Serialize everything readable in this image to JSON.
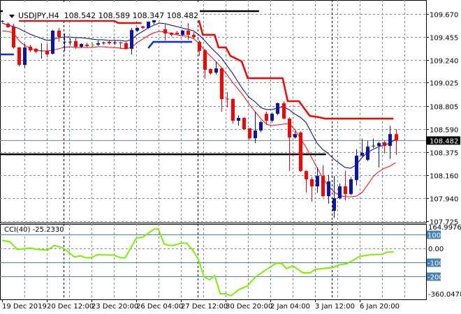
{
  "header": {
    "symbol": "USDJPY,H4",
    "ohlc": "108.542 108.589 108.347 108.482"
  },
  "cci_header": {
    "label": "CCI(40) -25.2330"
  },
  "colors": {
    "bull": "#0a14a8",
    "bear": "#ff0000",
    "doji_highlight": "#00ee00",
    "ma_line": "#000080",
    "lower_line": "#ff0000",
    "step_line": "#ff0000",
    "blue_step": "#0a28ff",
    "cci_line": "#7cf000",
    "cci_level": "#4682b4",
    "grid": "#778899"
  },
  "chart_data": [
    {
      "type": "candlestick",
      "title": "USDJPY,H4",
      "ylim": [
        107.725,
        109.67
      ],
      "y_ticks": [
        "109.670",
        "109.455",
        "109.240",
        "109.025",
        "108.805",
        "108.590",
        "108.375",
        "108.160",
        "107.940",
        "107.725"
      ],
      "current_price": "108.482",
      "x_labels": [
        "19 Dec 2019",
        "20 Dec 12:00",
        "23 Dec 20:00",
        "26 Dec 04:00",
        "27 Dec 12:00",
        "30 Dec 20:00",
        "2 Jan 04:00",
        "3 Jan 12:00",
        "6 Jan 20:00"
      ],
      "highlight_candle": 16,
      "candles_ohlc": [
        [
          109.6,
          109.61,
          109.59,
          109.605
        ],
        [
          109.578,
          109.59,
          109.54,
          109.546
        ],
        [
          109.552,
          109.578,
          109.343,
          109.356
        ],
        [
          109.356,
          109.36,
          109.179,
          109.192
        ],
        [
          109.192,
          109.388,
          109.166,
          109.356
        ],
        [
          109.362,
          109.38,
          109.31,
          109.329
        ],
        [
          109.343,
          109.35,
          109.3,
          109.316
        ],
        [
          109.32,
          109.395,
          109.251,
          109.326
        ],
        [
          109.323,
          109.388,
          109.264,
          109.29
        ],
        [
          109.297,
          109.52,
          109.29,
          109.513
        ],
        [
          109.513,
          109.539,
          109.408,
          109.454
        ],
        [
          109.405,
          109.487,
          109.323,
          109.41
        ],
        [
          109.405,
          109.441,
          109.375,
          109.41
        ],
        [
          109.415,
          109.441,
          109.343,
          109.362
        ],
        [
          109.362,
          109.395,
          109.35,
          109.388
        ],
        [
          109.382,
          109.401,
          109.356,
          109.369
        ],
        [
          109.382,
          109.4,
          109.36,
          109.382
        ],
        [
          109.382,
          109.42,
          109.37,
          109.395
        ],
        [
          109.395,
          109.41,
          109.38,
          109.401
        ],
        [
          109.408,
          109.42,
          109.38,
          109.395
        ],
        [
          109.398,
          109.42,
          109.38,
          109.402
        ],
        [
          109.402,
          109.41,
          109.343,
          109.398
        ],
        [
          109.395,
          109.408,
          109.336,
          109.343
        ],
        [
          109.343,
          109.539,
          109.29,
          109.519
        ],
        [
          109.513,
          109.546,
          109.5,
          109.539
        ],
        [
          109.552,
          109.56,
          109.53,
          109.539
        ],
        [
          109.539,
          109.6,
          109.53,
          109.598
        ],
        [
          109.591,
          109.67,
          109.572,
          109.624
        ],
        [
          109.635,
          109.67,
          109.605,
          109.64
        ],
        [
          109.526,
          109.572,
          109.421,
          109.487
        ],
        [
          109.493,
          109.5,
          109.46,
          109.474
        ],
        [
          109.493,
          109.51,
          109.47,
          109.48
        ],
        [
          109.474,
          109.52,
          109.46,
          109.513
        ],
        [
          109.513,
          109.585,
          109.428,
          109.474
        ],
        [
          109.474,
          109.5,
          109.44,
          109.454
        ],
        [
          109.408,
          109.421,
          109.277,
          109.323
        ],
        [
          109.329,
          109.34,
          109.061,
          109.146
        ],
        [
          109.153,
          109.16,
          109.1,
          109.113
        ],
        [
          109.12,
          109.225,
          109.1,
          109.159
        ],
        [
          109.159,
          109.17,
          108.753,
          108.871
        ],
        [
          108.875,
          108.936,
          108.792,
          108.868
        ],
        [
          108.871,
          108.88,
          108.64,
          108.668
        ],
        [
          108.668,
          108.72,
          108.62,
          108.694
        ],
        [
          108.694,
          108.7,
          108.58,
          108.589
        ],
        [
          108.596,
          108.6,
          108.49,
          108.504
        ],
        [
          108.504,
          108.753,
          108.458,
          108.576
        ],
        [
          108.576,
          108.67,
          108.56,
          108.655
        ],
        [
          108.733,
          108.753,
          108.63,
          108.668
        ],
        [
          108.668,
          108.745,
          108.65,
          108.733
        ],
        [
          108.733,
          108.84,
          108.72,
          108.832
        ],
        [
          108.832,
          108.85,
          108.68,
          108.688
        ],
        [
          108.688,
          108.7,
          108.196,
          108.511
        ],
        [
          108.511,
          108.57,
          108.5,
          108.543
        ],
        [
          108.557,
          108.57,
          108.19,
          108.196
        ],
        [
          108.196,
          108.2,
          107.993,
          108.118
        ],
        [
          108.118,
          108.14,
          107.908,
          108.052
        ],
        [
          108.052,
          108.23,
          107.99,
          108.15
        ],
        [
          108.15,
          108.25,
          107.95,
          107.96
        ],
        [
          107.96,
          108.16,
          107.89,
          108.098
        ],
        [
          107.823,
          108.15,
          107.757,
          107.941
        ],
        [
          107.941,
          108.08,
          107.93,
          108.052
        ],
        [
          108.052,
          108.2,
          107.92,
          107.98
        ],
        [
          107.98,
          108.14,
          107.97,
          108.118
        ],
        [
          108.111,
          108.4,
          108.06,
          108.34
        ],
        [
          108.34,
          108.5,
          108.33,
          108.367
        ],
        [
          108.301,
          108.48,
          108.29,
          108.425
        ],
        [
          108.428,
          108.5,
          108.41,
          108.434
        ],
        [
          108.432,
          108.47,
          108.23,
          108.458
        ],
        [
          108.465,
          108.48,
          108.36,
          108.432
        ],
        [
          108.432,
          108.62,
          108.31,
          108.543
        ],
        [
          108.542,
          108.589,
          108.347,
          108.482
        ]
      ],
      "ma_line": [
        109.585,
        109.565,
        109.552,
        109.533,
        109.506,
        109.48,
        109.46,
        109.441,
        109.421,
        109.428,
        109.447,
        109.454,
        109.454,
        109.447,
        109.447,
        109.441,
        109.434,
        109.428,
        109.428,
        109.421,
        109.421,
        109.421,
        109.415,
        109.428,
        109.474,
        109.506,
        109.539,
        109.565,
        109.585,
        109.578,
        109.565,
        109.552,
        109.539,
        109.526,
        109.513,
        109.474,
        109.421,
        109.362,
        109.31,
        109.257,
        109.185,
        109.113,
        109.028,
        108.95,
        108.884,
        108.845,
        108.792,
        108.773,
        108.773,
        108.786,
        108.799,
        108.773,
        108.733,
        108.701,
        108.655,
        108.557,
        108.458,
        108.399,
        108.36,
        108.308,
        108.268,
        108.229,
        108.222,
        108.255,
        108.321,
        108.373,
        108.399,
        108.425,
        108.439,
        108.458,
        108.497
      ],
      "lower_line": [
        109.513,
        109.506,
        109.493,
        109.421,
        109.375,
        109.349,
        109.329,
        109.323,
        109.323,
        109.329,
        109.343,
        109.356,
        109.362,
        109.356,
        109.356,
        109.356,
        109.356,
        109.362,
        109.362,
        109.356,
        109.356,
        109.349,
        109.343,
        109.356,
        109.401,
        109.434,
        109.467,
        109.493,
        109.506,
        109.5,
        109.487,
        109.474,
        109.467,
        109.46,
        109.441,
        109.395,
        109.329,
        109.277,
        109.225,
        109.166,
        109.1,
        109.028,
        108.963,
        108.897,
        108.819,
        108.753,
        108.688,
        108.635,
        108.622,
        108.629,
        108.635,
        108.642,
        108.589,
        108.504,
        108.425,
        108.327,
        108.229,
        108.131,
        108.059,
        108.0,
        107.967,
        107.954,
        107.954,
        107.96,
        107.993,
        108.065,
        108.144,
        108.19,
        108.222,
        108.242,
        108.275
      ],
      "step_line_segments": [
        [
          [
            3.0,
            109.605
          ],
          [
            19.9,
            109.605
          ],
          [
            20.7,
            109.585
          ],
          [
            24.8,
            109.585
          ]
        ],
        [
          [
            34.8,
            109.65
          ],
          [
            35.7,
            109.474
          ],
          [
            37.8,
            109.474
          ],
          [
            38.5,
            109.356
          ],
          [
            39.8,
            109.356
          ],
          [
            40.6,
            109.277
          ],
          [
            42.6,
            109.225
          ],
          [
            43.7,
            109.067
          ],
          [
            49.9,
            109.067
          ],
          [
            50.8,
            108.851
          ],
          [
            52.8,
            108.851
          ],
          [
            54.7,
            108.714
          ],
          [
            56.3,
            108.701
          ],
          [
            57.4,
            108.688
          ],
          [
            69.6,
            108.688
          ]
        ]
      ],
      "blue_step_segments": [
        [
          [
            -0.4,
            109.29
          ],
          [
            2.1,
            109.29
          ]
        ],
        [
          [
            26.0,
            109.349
          ],
          [
            26.9,
            109.408
          ],
          [
            33.8,
            109.408
          ]
        ]
      ],
      "horizontal_lines": [
        {
          "price": 109.696,
          "to_bar": 45.7
        },
        {
          "price": 108.353,
          "to_bar": 57.6
        }
      ],
      "separators_at_bar": [
        10.9,
        34.8,
        58.6
      ]
    },
    {
      "type": "line",
      "title": "CCI(40) -25.2330",
      "ylim": [
        -360.0478,
        164.9976
      ],
      "y_labels": [
        "164.9976",
        "0.00",
        "-360.0478"
      ],
      "levels": [
        "100",
        "-100",
        "-200"
      ],
      "zero_level": 0,
      "points": [
        [
          0,
          58
        ],
        [
          1.4,
          47
        ],
        [
          2.7,
          -7
        ],
        [
          5,
          2
        ],
        [
          6.2,
          -7
        ],
        [
          8.1,
          -12
        ],
        [
          9.3,
          22
        ],
        [
          10.9,
          2
        ],
        [
          12.9,
          -62
        ],
        [
          13.9,
          -53
        ],
        [
          14.9,
          -67
        ],
        [
          15.8,
          -67
        ],
        [
          17,
          -45
        ],
        [
          19.9,
          -48
        ],
        [
          21.1,
          -67
        ],
        [
          21.9,
          -67
        ],
        [
          23.9,
          75
        ],
        [
          25,
          80
        ],
        [
          27,
          138
        ],
        [
          27.8,
          138
        ],
        [
          28.8,
          33
        ],
        [
          29.6,
          22
        ],
        [
          30.6,
          22
        ],
        [
          31.8,
          38
        ],
        [
          32.8,
          38
        ],
        [
          33.9,
          -12
        ],
        [
          34.9,
          -78
        ],
        [
          35.9,
          -203
        ],
        [
          36.9,
          -225
        ],
        [
          37.8,
          -195
        ],
        [
          38.8,
          -325
        ],
        [
          39.8,
          -325
        ],
        [
          40.7,
          -340
        ],
        [
          42.1,
          -295
        ],
        [
          43.6,
          -270
        ],
        [
          45.1,
          -203
        ],
        [
          47.9,
          -128
        ],
        [
          48.7,
          -107
        ],
        [
          49.7,
          -107
        ],
        [
          50.6,
          -145
        ],
        [
          51.7,
          -125
        ],
        [
          53.5,
          -175
        ],
        [
          54.8,
          -175
        ],
        [
          55.7,
          -150
        ],
        [
          58.9,
          -137
        ],
        [
          59.8,
          -120
        ],
        [
          61.5,
          -107
        ],
        [
          63.6,
          -57
        ],
        [
          65.6,
          -45
        ],
        [
          67.6,
          -42
        ],
        [
          68.4,
          -28
        ],
        [
          69.6,
          -25
        ]
      ]
    }
  ]
}
